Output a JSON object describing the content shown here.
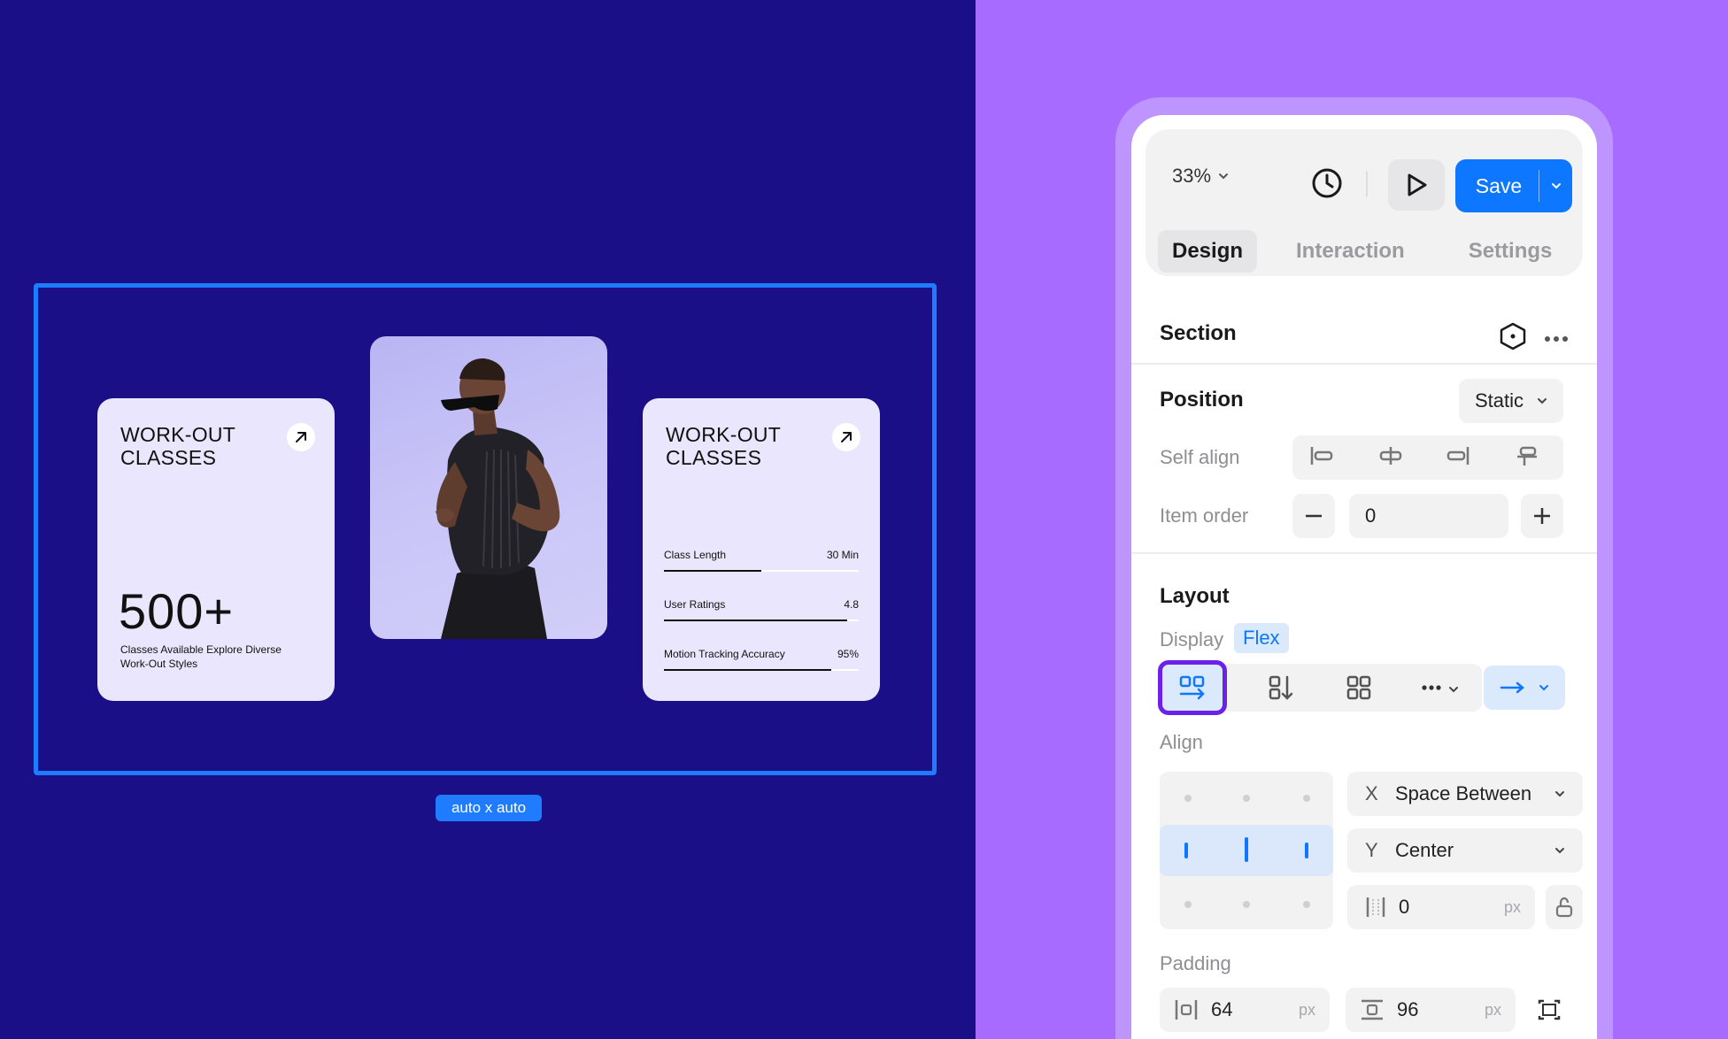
{
  "canvas": {
    "size_badge": "auto x auto",
    "card_left": {
      "title": "WORK-OUT CLASSES",
      "stat": "500+",
      "description": "Classes Available Explore Diverse Work-Out Styles"
    },
    "card_right": {
      "title": "WORK-OUT CLASSES",
      "metrics": [
        {
          "label": "Class Length",
          "value": "30 Min",
          "progress": 0.5
        },
        {
          "label": "User Ratings",
          "value": "4.8",
          "progress": 0.94
        },
        {
          "label": "Motion Tracking Accuracy",
          "value": "95%",
          "progress": 0.86
        }
      ]
    }
  },
  "panel": {
    "zoom": "33%",
    "save_label": "Save",
    "tabs": [
      "Design",
      "Interaction",
      "Settings"
    ],
    "section_title": "Section",
    "position": {
      "title": "Position",
      "value": "Static",
      "self_align_label": "Self align",
      "item_order_label": "Item order",
      "item_order_value": "0"
    },
    "layout": {
      "title": "Layout",
      "display_label": "Display",
      "display_value": "Flex",
      "align_label": "Align",
      "x_axis": "X",
      "x_value": "Space Between",
      "y_axis": "Y",
      "y_value": "Center",
      "gap_value": "0",
      "gap_unit": "px"
    },
    "padding": {
      "label": "Padding",
      "horizontal": "64",
      "vertical": "96",
      "unit": "px"
    }
  },
  "colors": {
    "canvas_bg": "#1a0f86",
    "selection": "#1f7cff",
    "right_bg": "#a76bff",
    "accent": "#0d78ff",
    "flex_highlight": "#6b21e8"
  }
}
